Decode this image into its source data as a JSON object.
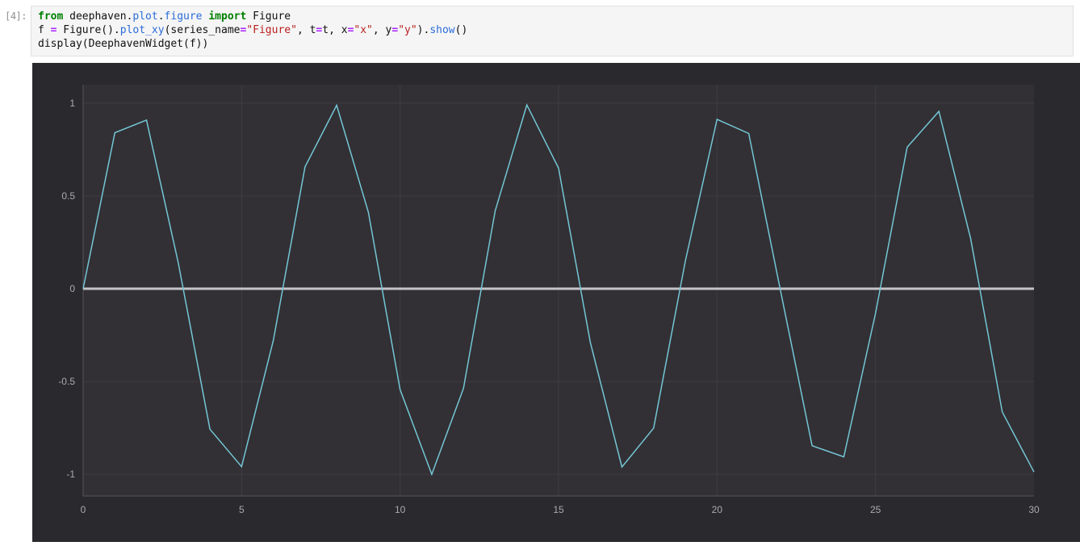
{
  "notebook": {
    "cell": {
      "prompt": "[4]:",
      "language": "python",
      "code_lines": [
        [
          {
            "t": "from",
            "c": "kw"
          },
          {
            "t": " deephaven.",
            "c": "pl"
          },
          {
            "t": "plot",
            "c": "prop"
          },
          {
            "t": ".",
            "c": "pl"
          },
          {
            "t": "figure",
            "c": "prop"
          },
          {
            "t": " ",
            "c": "pl"
          },
          {
            "t": "import",
            "c": "kw"
          },
          {
            "t": " Figure",
            "c": "pl"
          }
        ],
        [
          {
            "t": "f ",
            "c": "pl"
          },
          {
            "t": "=",
            "c": "op"
          },
          {
            "t": " Figure().",
            "c": "pl"
          },
          {
            "t": "plot_xy",
            "c": "prop"
          },
          {
            "t": "(series_name",
            "c": "pl"
          },
          {
            "t": "=",
            "c": "op"
          },
          {
            "t": "\"Figure\"",
            "c": "str"
          },
          {
            "t": ", t",
            "c": "pl"
          },
          {
            "t": "=",
            "c": "op"
          },
          {
            "t": "t, x",
            "c": "pl"
          },
          {
            "t": "=",
            "c": "op"
          },
          {
            "t": "\"x\"",
            "c": "str"
          },
          {
            "t": ", y",
            "c": "pl"
          },
          {
            "t": "=",
            "c": "op"
          },
          {
            "t": "\"y\"",
            "c": "str"
          },
          {
            "t": ").",
            "c": "pl"
          },
          {
            "t": "show",
            "c": "prop"
          },
          {
            "t": "()",
            "c": "pl"
          }
        ],
        [
          {
            "t": "display(DeephavenWidget(f))",
            "c": "pl"
          }
        ]
      ]
    }
  },
  "chart_data": {
    "type": "line",
    "title": "",
    "xlabel": "",
    "ylabel": "",
    "xlim": [
      0,
      30
    ],
    "ylim": [
      -1.117,
      1.1
    ],
    "x_ticks": [
      0,
      5,
      10,
      15,
      20,
      25,
      30
    ],
    "y_ticks": [
      -1,
      -0.5,
      0,
      0.5,
      1
    ],
    "grid": true,
    "legend": "none",
    "zero_line": true,
    "series": [
      {
        "name": "Figure",
        "color": "#74c6d6",
        "x": [
          0,
          1,
          2,
          3,
          4,
          5,
          6,
          7,
          8,
          9,
          10,
          11,
          12,
          13,
          14,
          15,
          16,
          17,
          18,
          19,
          20,
          21,
          22,
          23,
          24,
          25,
          26,
          27,
          28,
          29,
          30
        ],
        "y": [
          0.0,
          0.841,
          0.909,
          0.141,
          -0.757,
          -0.959,
          -0.279,
          0.657,
          0.989,
          0.412,
          -0.544,
          -1.0,
          -0.537,
          0.42,
          0.991,
          0.65,
          -0.288,
          -0.961,
          -0.751,
          0.15,
          0.913,
          0.837,
          -0.009,
          -0.846,
          -0.906,
          -0.132,
          0.763,
          0.956,
          0.271,
          -0.664,
          -0.988
        ]
      }
    ],
    "colors": {
      "widget_bg": "#2a292d",
      "plot_bg": "#323034",
      "grid": "#3f3d44",
      "axis_line": "#57555b",
      "zero_line": "#c4c3c8",
      "tick_label": "#ababaf",
      "series": "#74c6d6"
    }
  }
}
